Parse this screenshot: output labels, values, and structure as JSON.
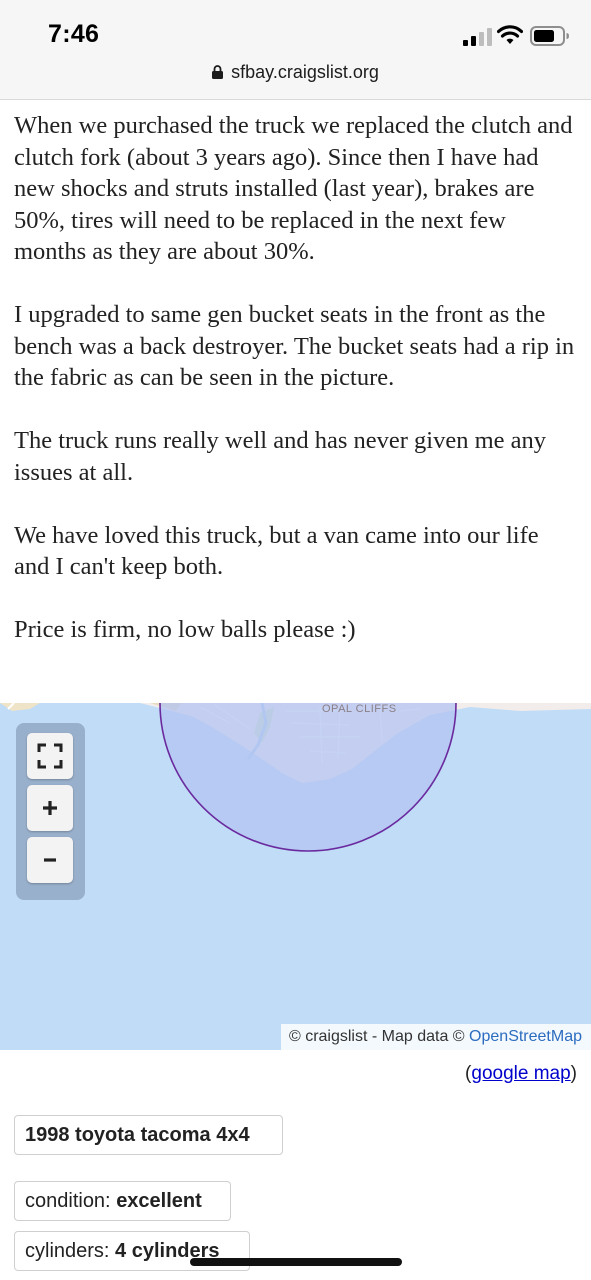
{
  "status_bar": {
    "time": "7:46",
    "url": "sfbay.craigslist.org",
    "icons": [
      "signal-icon",
      "wifi-icon",
      "battery-icon",
      "lock-icon"
    ]
  },
  "post": {
    "paragraphs": [
      "When we purchased the truck we replaced the clutch and clutch fork (about 3 years ago). Since then I have had new shocks and struts installed (last year), brakes are 50%, tires will need to be replaced in the next few months as they are about 30%.",
      "I upgraded to same gen bucket seats in the front as the bench was a back destroyer. The bucket seats had a rip in the fabric as can be seen in the picture.",
      "The truck runs really well and has never given me any issues at all.",
      "We have loved this truck, but a van came into our life and I can't keep both.",
      "Price is firm, no low balls please :)"
    ]
  },
  "map": {
    "place_label": "OPAL CLIFFS",
    "controls": {
      "fullscreen": "fullscreen-icon",
      "zoom_in": "+",
      "zoom_out": "−"
    },
    "attribution_prefix": "© craigslist - Map data ©",
    "attribution_link": "OpenStreetMap",
    "colors": {
      "water": "#c0dcf7",
      "land": "#f2ecea",
      "radius_fill": "#b9c6f0",
      "radius_stroke": "#6a2a9e"
    }
  },
  "google_map": {
    "open": "(",
    "link": "google map",
    "close": ")"
  },
  "attributes": {
    "title": "1998 toyota tacoma 4x4",
    "condition_label": "condition:",
    "condition_value": "excellent",
    "cylinders_label": "cylinders:",
    "cylinders_value": "4 cylinders"
  }
}
